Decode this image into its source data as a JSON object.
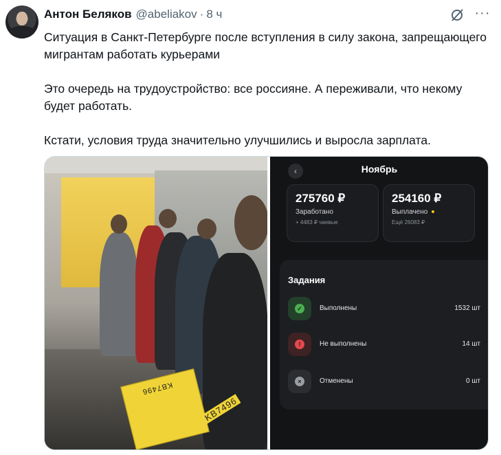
{
  "author": {
    "name": "Антон Беляков",
    "handle": "@abeliakov",
    "separator": "·",
    "time": "8 ч"
  },
  "icons": {
    "grok": "grok-icon",
    "more": "more-icon",
    "more_glyph": "···"
  },
  "tweet": {
    "paragraphs": [
      "Ситуация в Санкт-Петербурге после вступления в силу закона, запрещающего мигрантам работать курьерами",
      "Это очередь на трудоустройство: все россияне. А переживали, что некому будет работать.",
      "Кстати, условия труда значительно улучшились и выросла зарплата."
    ]
  },
  "photo": {
    "box_label_1": "KB7496",
    "box_label_2": "KB7496"
  },
  "app": {
    "back_glyph": "‹",
    "title": "Ноябрь",
    "earned": {
      "amount": "275760 ₽",
      "label": "Заработано",
      "sub": "+ 4483 ₽ чаевые"
    },
    "paid": {
      "amount": "254160 ₽",
      "label": "Выплачено",
      "sub": "Ещё 26083 ₽"
    },
    "tasks_title": "Задания",
    "tasks": [
      {
        "label": "Выполнены",
        "value": "1532 шт",
        "icon": "check-icon",
        "glyph": "✓",
        "color": "#4caf50",
        "bg": "#23402a"
      },
      {
        "label": "Не выполнены",
        "value": "14 шт",
        "icon": "warning-icon",
        "glyph": "!",
        "color": "#e5484d",
        "bg": "#3f2224"
      },
      {
        "label": "Отменены",
        "value": "0 шт",
        "icon": "cancel-icon",
        "glyph": "×",
        "color": "#9a9da1",
        "bg": "#2b2d31"
      }
    ]
  },
  "colors": {
    "text": "#0f1419",
    "muted": "#536471",
    "app_bg": "#121416",
    "accent_yellow": "#f5c518"
  }
}
